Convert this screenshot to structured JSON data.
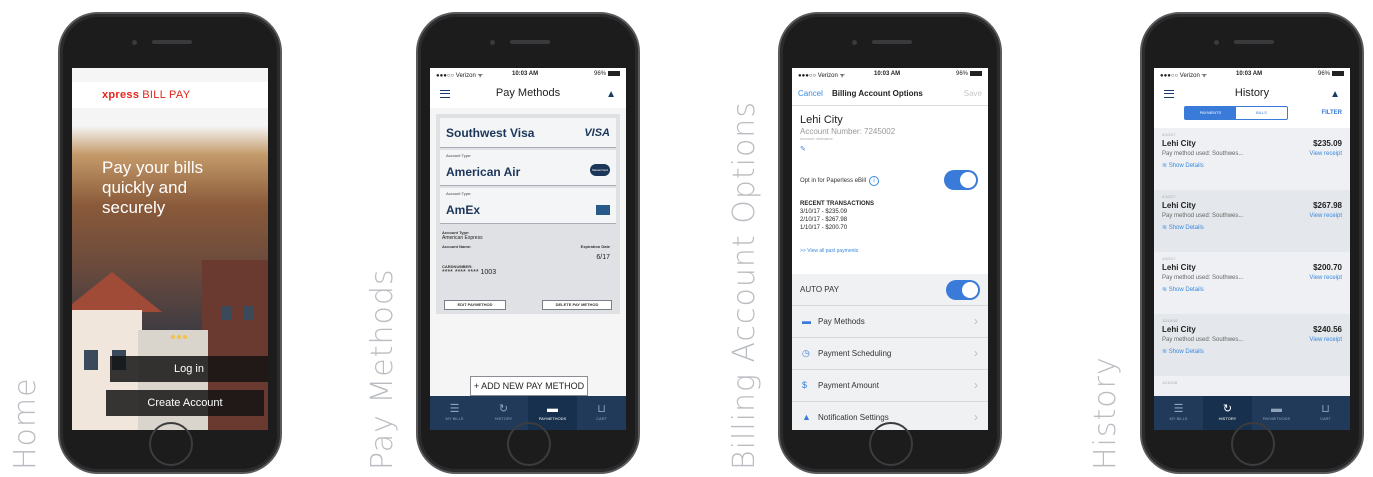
{
  "labels": {
    "home": "Home",
    "pay_methods": "Pay Methods",
    "billing": "Billing Account Options",
    "history": "History"
  },
  "status_bar": {
    "carrier": "●●●○○ Verizon ᯤ",
    "time": "10:03 AM",
    "battery": "96%"
  },
  "home": {
    "brand_bold": "xpress",
    "brand_rest": "BILL PAY",
    "headline": "Pay your bills quickly and securely",
    "login_label": "Log in",
    "create_label": "Create Account"
  },
  "tabs": {
    "my_bills": "MY BILLS",
    "history": "HISTORY",
    "pay_methods": "PAYMETHODS",
    "cart": "CART"
  },
  "pay_methods": {
    "title": "Pay Methods",
    "cards": [
      {
        "name": "Southwest Visa",
        "logo": "VISA"
      },
      {
        "type_label": "Account Type:",
        "name": "American Air",
        "logo": "MasterCard"
      },
      {
        "type_label": "Account Type:",
        "name": "AmEx"
      }
    ],
    "details": {
      "account_type_label": "Account Type:",
      "account_type": "American Express",
      "account_name_label": "Account Name:",
      "expiration_label": "Expiration Date",
      "expiration": "6/17",
      "card_number_label": "CARDNUMBER:",
      "card_number": "**** **** **** 1003"
    },
    "edit_label": "EDIT PAYMETHOD",
    "delete_label": "DELETE PAY METHOD",
    "add_label": "+ ADD NEW PAY METHOD"
  },
  "billing": {
    "cancel": "Cancel",
    "title": "Billing Account Options",
    "save": "Save",
    "city": "Lehi City",
    "account_number": "Account Number: 7245002",
    "nickname": "Account nickname",
    "pencil": "✎",
    "optin": "Opt in for Paperless eBill",
    "recent_header": "RECENT TRANSACTIONS",
    "transactions": [
      "3/10/17 - $235.09",
      "2/10/17 - $267.98",
      "1/10/17 - $200.70"
    ],
    "view_all": ">> View all past payments",
    "auto_pay": "AUTO PAY",
    "rows": [
      "Pay Methods",
      "Payment Scheduling",
      "Payment Amount",
      "Notification Settings"
    ]
  },
  "history": {
    "title": "History",
    "seg_payments": "PAYMENTS",
    "seg_bills": "BILLS",
    "filter": "FILTER",
    "items": [
      {
        "date": "3/10/17",
        "name": "Lehi City",
        "amount": "$235.09",
        "used": "Pay method used: Southwes...",
        "receipt": "View receipt",
        "show": "≋ Show Details"
      },
      {
        "date": "2/10/17",
        "name": "Lehi City",
        "amount": "$267.98",
        "used": "Pay method used: Southwes...",
        "receipt": "View receipt",
        "show": "≋ Show Details"
      },
      {
        "date": "1/10/17",
        "name": "Lehi City",
        "amount": "$200.70",
        "used": "Pay method used: Southwes...",
        "receipt": "View receipt",
        "show": "≋ Show Details"
      },
      {
        "date": "12/10/16",
        "name": "Lehi City",
        "amount": "$240.56",
        "used": "Pay method used: Southwes...",
        "receipt": "View receipt",
        "show": "≋ Show Details"
      }
    ],
    "last_date": "11/10/16"
  }
}
